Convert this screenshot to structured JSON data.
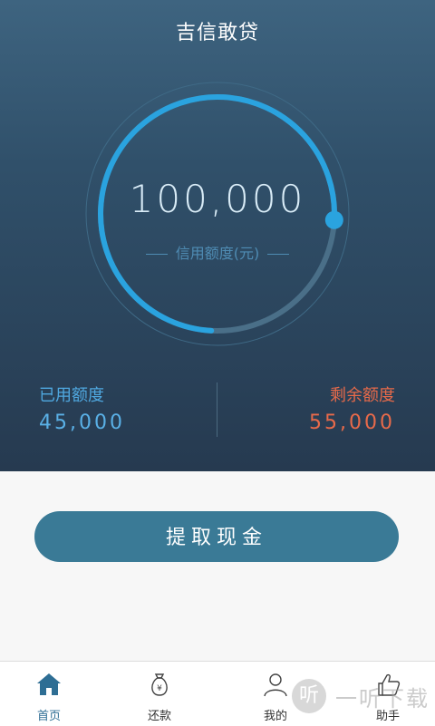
{
  "header": {
    "title": "吉信敢贷"
  },
  "credit": {
    "amount": "100,000",
    "label": "信用额度(元)",
    "used_fraction": 0.25
  },
  "used": {
    "label": "已用额度",
    "value": "45,000"
  },
  "remaining": {
    "label": "剩余额度",
    "value": "55,000"
  },
  "actions": {
    "withdraw_label": "提取现金"
  },
  "tabs": [
    {
      "label": "首页",
      "icon": "home-icon",
      "active": true
    },
    {
      "label": "还款",
      "icon": "money-bag-icon",
      "active": false
    },
    {
      "label": "我的",
      "icon": "user-icon",
      "active": false
    },
    {
      "label": "助手",
      "icon": "thumbs-up-icon",
      "active": false
    }
  ],
  "watermark": {
    "glyph": "听",
    "text": "一听下载"
  },
  "colors": {
    "accent": "#2aa3df",
    "used": "#4fa8e0",
    "remaining": "#e86a4a",
    "button": "#3a7a96"
  }
}
